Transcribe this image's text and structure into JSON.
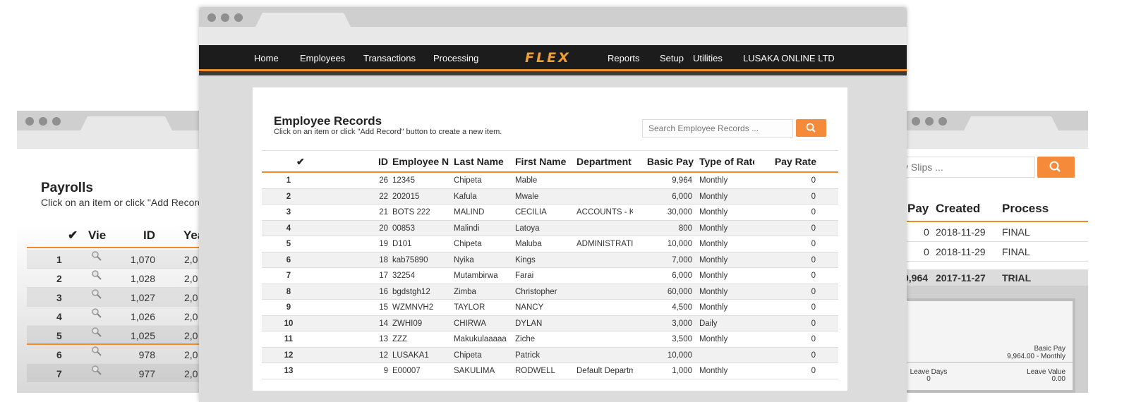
{
  "left_window": {
    "title": "Payrolls",
    "subtitle": "Click on an item or click \"Add Record\"",
    "columns": [
      "✔",
      "Vie",
      "ID",
      "Yea"
    ],
    "rows": [
      {
        "n": "1",
        "id": "1,070",
        "year": "2,0"
      },
      {
        "n": "2",
        "id": "1,028",
        "year": "2,0"
      },
      {
        "n": "3",
        "id": "1,027",
        "year": "2,0"
      },
      {
        "n": "4",
        "id": "1,026",
        "year": "2,0"
      },
      {
        "n": "5",
        "id": "1,025",
        "year": "2,0"
      },
      {
        "n": "6",
        "id": "978",
        "year": "2,0"
      },
      {
        "n": "7",
        "id": "977",
        "year": "2,0"
      }
    ]
  },
  "right_window": {
    "search_placeholder": "y Slips ...",
    "columns": [
      "Pay",
      "Created",
      "Process"
    ],
    "rows": [
      {
        "pay": "0",
        "created": "2018-11-29",
        "process": "FINAL"
      },
      {
        "pay": "0",
        "created": "2018-11-29",
        "process": "FINAL"
      },
      {
        "pay": "9,964",
        "created": "2017-11-27",
        "process": "TRIAL"
      }
    ],
    "detail": {
      "basic_pay_label": "Basic Pay",
      "basic_pay_value": "9,964.00 - Monthly",
      "leave_days_label": "Leave Days",
      "leave_days_value": "0",
      "leave_value_label": "Leave Value",
      "leave_value_value": "0.00"
    }
  },
  "center_window": {
    "nav": {
      "home": "Home",
      "employees": "Employees",
      "transactions": "Transactions",
      "processing": "Processing",
      "logo": "FLEX",
      "reports": "Reports",
      "setup": "Setup",
      "utilities": "Utilities",
      "company": "LUSAKA ONLINE LTD"
    },
    "title": "Employee Records",
    "subtitle": "Click on an item or click \"Add Record\" button to create a new item.",
    "search_placeholder": "Search Employee Records ...",
    "columns": {
      "check": "✔",
      "id": "ID",
      "employee_no": "Employee N",
      "last_name": "Last Name",
      "first_name": "First Name",
      "department": "Department",
      "basic_pay": "Basic Pay",
      "rate_type": "Type of Rate",
      "pay_rate": "Pay Rate"
    },
    "rows": [
      {
        "n": "1",
        "id": "26",
        "emp": "12345",
        "last": "Chipeta",
        "first": "Mable",
        "dept": "",
        "pay": "9,964",
        "rate": "Monthly",
        "payrate": "0"
      },
      {
        "n": "2",
        "id": "22",
        "emp": "202015",
        "last": "Kafula",
        "first": "Mwale",
        "dept": "",
        "pay": "6,000",
        "rate": "Monthly",
        "payrate": "0"
      },
      {
        "n": "3",
        "id": "21",
        "emp": "BOTS 222",
        "last": "MALIND",
        "first": "CECILIA",
        "dept": "ACCOUNTS - K",
        "pay": "30,000",
        "rate": "Monthly",
        "payrate": "0"
      },
      {
        "n": "4",
        "id": "20",
        "emp": "00853",
        "last": "Malindi",
        "first": "Latoya",
        "dept": "",
        "pay": "800",
        "rate": "Monthly",
        "payrate": "0"
      },
      {
        "n": "5",
        "id": "19",
        "emp": "D101",
        "last": "Chipeta",
        "first": "Maluba",
        "dept": "ADMINISTRATI",
        "pay": "10,000",
        "rate": "Monthly",
        "payrate": "0"
      },
      {
        "n": "6",
        "id": "18",
        "emp": "kab75890",
        "last": "Nyika",
        "first": "Kings",
        "dept": "",
        "pay": "7,000",
        "rate": "Monthly",
        "payrate": "0"
      },
      {
        "n": "7",
        "id": "17",
        "emp": "32254",
        "last": "Mutambirwa",
        "first": "Farai",
        "dept": "",
        "pay": "6,000",
        "rate": "Monthly",
        "payrate": "0"
      },
      {
        "n": "8",
        "id": "16",
        "emp": "bgdstgh12",
        "last": "Zimba",
        "first": "Christopher",
        "dept": "",
        "pay": "60,000",
        "rate": "Monthly",
        "payrate": "0"
      },
      {
        "n": "9",
        "id": "15",
        "emp": "WZMNVH2",
        "last": "TAYLOR",
        "first": "NANCY",
        "dept": "",
        "pay": "4,500",
        "rate": "Monthly",
        "payrate": "0"
      },
      {
        "n": "10",
        "id": "14",
        "emp": "ZWHI09",
        "last": "CHIRWA",
        "first": "DYLAN",
        "dept": "",
        "pay": "3,000",
        "rate": "Daily",
        "payrate": "0"
      },
      {
        "n": "11",
        "id": "13",
        "emp": "ZZZ",
        "last": "Makukulaaaaa",
        "first": "Ziche",
        "dept": "",
        "pay": "3,500",
        "rate": "Monthly",
        "payrate": "0"
      },
      {
        "n": "12",
        "id": "12",
        "emp": "LUSAKA1",
        "last": "Chipeta",
        "first": "Patrick",
        "dept": "",
        "pay": "10,000",
        "rate": "",
        "payrate": "0"
      },
      {
        "n": "13",
        "id": "9",
        "emp": "E00007",
        "last": "SAKULIMA",
        "first": "RODWELL",
        "dept": "Default Departm",
        "pay": "1,000",
        "rate": "Monthly",
        "payrate": "0"
      }
    ]
  },
  "colors": {
    "accent": "#f08a2c",
    "button": "#f58a3a",
    "navbar": "#1c1c1c",
    "logo": "#f0a030"
  }
}
